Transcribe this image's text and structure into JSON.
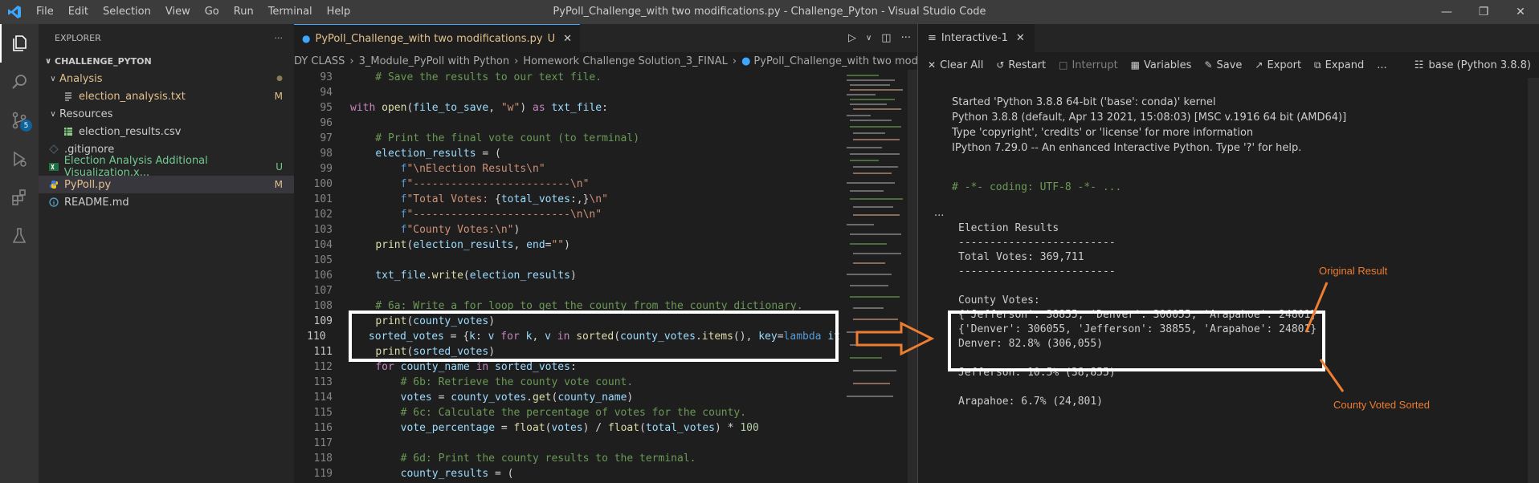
{
  "window": {
    "title": "PyPoll_Challenge_with two modifications.py - Challenge_Pyton - Visual Studio Code",
    "menu": [
      "File",
      "Edit",
      "Selection",
      "View",
      "Go",
      "Run",
      "Terminal",
      "Help"
    ]
  },
  "activity": {
    "scm_badge": "5"
  },
  "explorer": {
    "header": "EXPLORER",
    "section": "CHALLENGE_PYTON",
    "items": [
      {
        "label": "Analysis",
        "deco": "●"
      },
      {
        "label": "election_analysis.txt",
        "deco": "M"
      },
      {
        "label": "Resources",
        "deco": ""
      },
      {
        "label": "election_results.csv",
        "deco": ""
      },
      {
        "label": ".gitignore",
        "deco": ""
      },
      {
        "label": "Election Analysis Additional Visualization.x...",
        "deco": "U"
      },
      {
        "label": "PyPoll.py",
        "deco": "M"
      },
      {
        "label": "README.md",
        "deco": ""
      }
    ]
  },
  "editor": {
    "tab": {
      "label": "PyPoll_Challenge_with two modifications.py",
      "status": "U"
    },
    "breadcrumb": [
      "DY CLASS",
      "3_Module_PyPoll with Python",
      "Homework Challenge Solution_3_FINAL",
      "PyPoll_Challenge_with two modifications.py",
      "..."
    ],
    "line_numbers": [
      "93",
      "94",
      "95",
      "96",
      "97",
      "98",
      "99",
      "100",
      "101",
      "102",
      "103",
      "104",
      "105",
      "106",
      "107",
      "108",
      "109",
      "110",
      "111",
      "112",
      "113",
      "114",
      "115",
      "116",
      "117",
      "118",
      "119"
    ]
  },
  "interactive": {
    "tab": "Interactive-1",
    "toolbar": {
      "clear": "Clear All",
      "restart": "Restart",
      "interrupt": "Interrupt",
      "variables": "Variables",
      "save": "Save",
      "export": "Export",
      "expand": "Expand",
      "more": "...",
      "kernel": "base (Python 3.8.8)"
    },
    "banner": [
      "Started 'Python 3.8.8 64-bit ('base': conda)' kernel",
      "Python 3.8.8 (default, Apr 13 2021, 15:08:03) [MSC v.1916 64 bit (AMD64)]",
      "Type 'copyright', 'credits' or 'license' for more information",
      "IPython 7.29.0 -- An enhanced Interactive Python. Type '?' for help."
    ],
    "cell_code": "# -*- coding: UTF-8 -*- ...",
    "output": [
      "Election Results",
      "-------------------------",
      "Total Votes: 369,711",
      "-------------------------",
      "",
      "County Votes:",
      "{'Jefferson': 38855, 'Denver': 306055, 'Arapahoe': 24801}",
      "{'Denver': 306055, 'Jefferson': 38855, 'Arapahoe': 24801}",
      "Denver: 82.8% (306,055)",
      "",
      "Jefferson: 10.5% (38,855)",
      "",
      "Arapahoe: 6.7% (24,801)"
    ]
  },
  "annotations": {
    "original": "Original Result",
    "sorted": "County Voted Sorted",
    "accent": "#ed7d31"
  }
}
